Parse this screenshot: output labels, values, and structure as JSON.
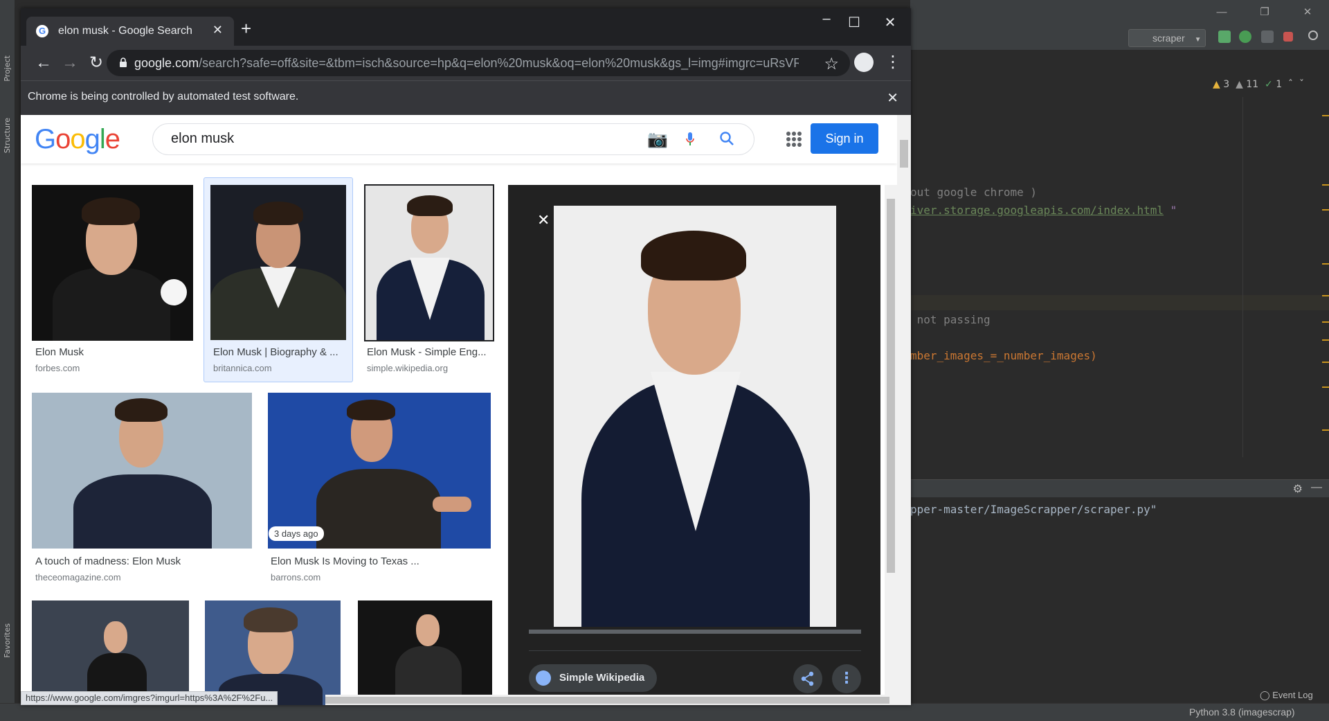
{
  "ide": {
    "labels": {
      "project": "Project",
      "structure": "Structure",
      "favorites": "Favorites"
    },
    "run_config": "scraper",
    "inspections": {
      "warnings": "3",
      "weak_warnings": "11",
      "ok": "1"
    },
    "code_lines": [
      {
        "text": "out google chrome )",
        "kind": "cmt"
      },
      {
        "text": "iver.storage.googleapis.com/index.html",
        "kind": "str",
        "suffix": " \""
      },
      {
        "text": " not passing",
        "kind": "cmt"
      },
      {
        "text": "mber_images_=_number_images)",
        "kind": "code"
      }
    ],
    "terminal_line": "pper-master/ImageScrapper/scraper.py\"",
    "event_log": "Event Log",
    "python": "Python 3.8 (imagescrap)",
    "colors": {
      "bg": "#2b2b2b",
      "panel": "#3c3f41",
      "warn": "#e5b33c"
    }
  },
  "browser": {
    "tab_title": "elon musk - Google Search",
    "new_tab": "+",
    "url_host": "google.com",
    "url_path": "/search?safe=off&site=&tbm=isch&source=hp&q=elon%20musk&oq=elon%20musk&gs_l=img#imgrc=uRsVR...",
    "infobar": "Chrome is being controlled by automated test software.",
    "status_url": "https://www.google.com/imgres?imgurl=https%3A%2F%2Fu..."
  },
  "google": {
    "query": "elon musk",
    "signin": "Sign in",
    "results": [
      {
        "title": "Elon Musk",
        "source": "forbes.com"
      },
      {
        "title": "Elon Musk | Biography & ...",
        "source": "britannica.com"
      },
      {
        "title": "Elon Musk - Simple Eng...",
        "source": "simple.wikipedia.org"
      },
      {
        "title": "A touch of madness: Elon Musk",
        "source": "theceomagazine.com"
      },
      {
        "title": "Elon Musk Is Moving to Texas ...",
        "source": "barrons.com",
        "badge": "3 days ago"
      }
    ],
    "viewer": {
      "source": "Simple Wikipedia"
    },
    "colors": {
      "blue": "#1a73e8",
      "red": "#ea4335",
      "yellow": "#fbbc05",
      "green": "#34a853"
    }
  }
}
